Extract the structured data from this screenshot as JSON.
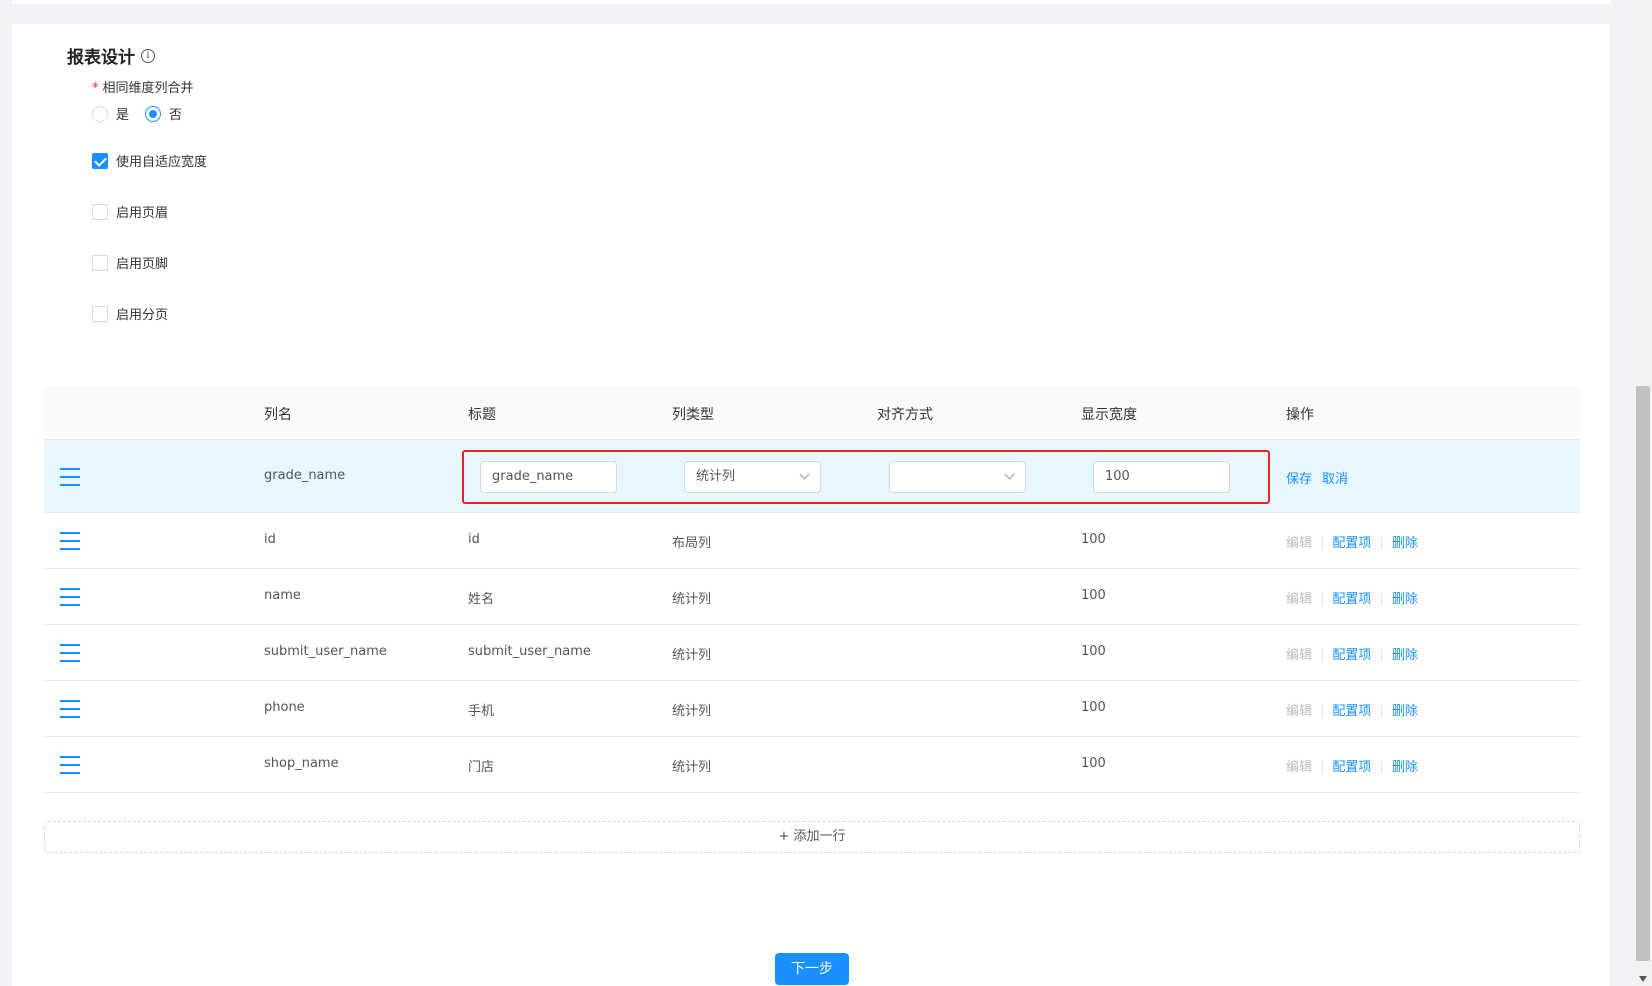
{
  "section": {
    "title": "报表设计",
    "info_icon": "i"
  },
  "merge_option": {
    "label": "相同维度列合并",
    "required_mark": "*",
    "options": [
      {
        "label": "是",
        "checked": false
      },
      {
        "label": "否",
        "checked": true
      }
    ]
  },
  "checkboxes": [
    {
      "label": "使用自适应宽度",
      "checked": true
    },
    {
      "label": "启用页眉",
      "checked": false
    },
    {
      "label": "启用页脚",
      "checked": false
    },
    {
      "label": "启用分页",
      "checked": false
    }
  ],
  "table": {
    "headers": [
      "列名",
      "标题",
      "列类型",
      "对齐方式",
      "显示宽度",
      "操作"
    ],
    "editing_row": {
      "column_name": "grade_name",
      "title_value": "grade_name",
      "type_value": "统计列",
      "align_value": "",
      "width_value": "100",
      "save_label": "保存",
      "cancel_label": "取消"
    },
    "rows": [
      {
        "column_name": "id",
        "title": "id",
        "type": "布局列",
        "width": "100"
      },
      {
        "column_name": "name",
        "title": "姓名",
        "type": "统计列",
        "width": "100"
      },
      {
        "column_name": "submit_user_name",
        "title": "submit_user_name",
        "type": "统计列",
        "width": "100"
      },
      {
        "column_name": "phone",
        "title": "手机",
        "type": "统计列",
        "width": "100"
      },
      {
        "column_name": "shop_name",
        "title": "门店",
        "type": "统计列",
        "width": "100"
      }
    ],
    "actions": {
      "edit": "编辑",
      "config": "配置项",
      "delete": "删除"
    }
  },
  "add_row_label": "+ 添加一行",
  "next_button": "下一步"
}
